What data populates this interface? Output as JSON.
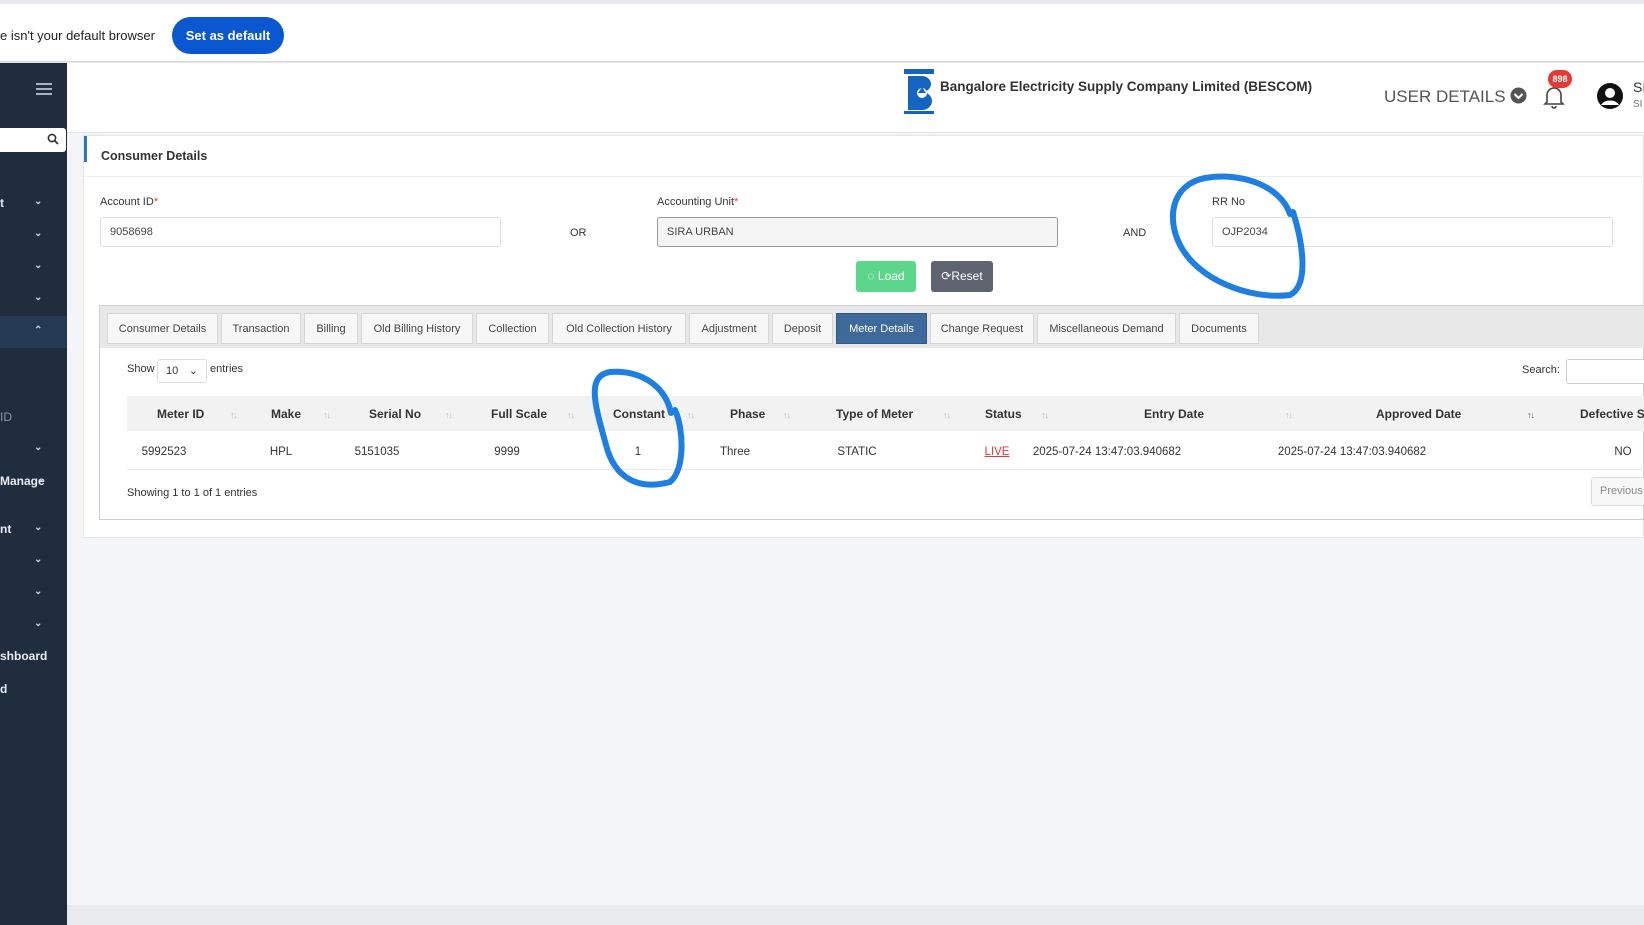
{
  "browser_banner": {
    "text": "e isn't your default browser",
    "button": "Set as default"
  },
  "sidebar": {
    "items": [
      {
        "label": "t",
        "chevron": "⌄"
      },
      {
        "label": "",
        "chevron": "⌄"
      },
      {
        "label": "",
        "chevron": "⌄"
      },
      {
        "label": "",
        "chevron": "⌄"
      },
      {
        "label": "",
        "chevron": "⌃"
      },
      {
        "label": "ID",
        "chevron": ""
      },
      {
        "label": "",
        "chevron": "⌄"
      },
      {
        "label": "Manage",
        "chevron": "⌄"
      },
      {
        "label": "nt",
        "chevron": "⌄"
      },
      {
        "label": "",
        "chevron": "⌄"
      },
      {
        "label": "",
        "chevron": "⌄"
      },
      {
        "label": "",
        "chevron": "⌄"
      },
      {
        "label": "shboard",
        "chevron": ""
      },
      {
        "label": "d",
        "chevron": ""
      }
    ]
  },
  "header": {
    "company": "Bangalore Electricity Supply Company Limited (BESCOM)",
    "user_details": "USER DETAILS",
    "notification_count": "898",
    "user_initial": "SI",
    "user_sub": "SI"
  },
  "card": {
    "title": "Consumer Details",
    "account_id": {
      "label": "Account ID",
      "required": "*",
      "value": "9058698"
    },
    "or": "OR",
    "accounting_unit": {
      "label": "Accounting Unit",
      "required": "*",
      "value": "SIRA URBAN"
    },
    "and": "AND",
    "rr_no": {
      "label": "RR No",
      "value": "OJP2034"
    },
    "load": "Load",
    "reset": "Reset"
  },
  "tabs": [
    "Consumer Details",
    "Transaction",
    "Billing",
    "Old Billing History",
    "Collection",
    "Old Collection History",
    "Adjustment",
    "Deposit",
    "Meter Details",
    "Change Request",
    "Miscellaneous Demand",
    "Documents"
  ],
  "active_tab": "Meter Details",
  "table": {
    "show": "Show",
    "page_size": "10",
    "entries": "entries",
    "search_label": "Search:",
    "columns": [
      "Meter ID",
      "Make",
      "Serial No",
      "Full Scale",
      "Constant",
      "Phase",
      "Type of Meter",
      "Status",
      "Entry Date",
      "Approved Date",
      "Defective S"
    ],
    "rows": [
      [
        "5992523",
        "HPL",
        "5151035",
        "9999",
        "1",
        "Three",
        "STATIC",
        "LIVE",
        "2025-07-24 13:47:03.940682",
        "2025-07-24 13:47:03.940682",
        "NO"
      ]
    ],
    "showing": "Showing 1 to 1 of 1 entries",
    "previous": "Previous"
  },
  "colors": {
    "sidebar": "#1f2d3d",
    "active_tab": "#3d6a9a",
    "load": "#5cd68a",
    "reset": "#5f6470",
    "status_live": "#e53935",
    "annotation": "#1e7fe0"
  }
}
